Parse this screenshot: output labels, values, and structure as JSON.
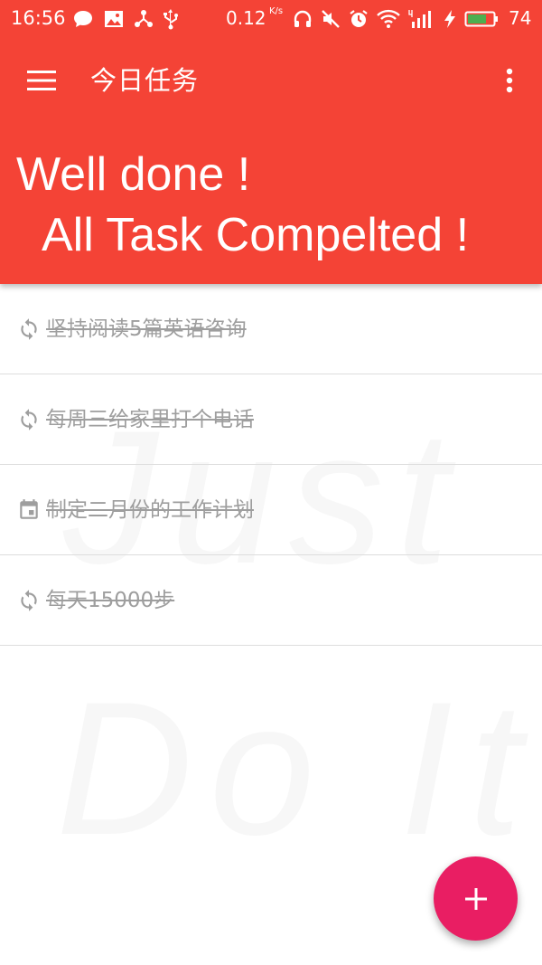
{
  "status_bar": {
    "time": "16:56",
    "net_speed": "0.12",
    "net_speed_unit": "K/s",
    "battery_level": "74",
    "battery_fill_fraction": 0.74,
    "left_icons": [
      "chat-icon",
      "image-icon",
      "share-icon",
      "usb-icon"
    ],
    "right_icons": [
      "headphones-icon",
      "mute-icon",
      "alarm-icon",
      "wifi-icon",
      "signal-4g-icon",
      "charging-icon",
      "battery-icon"
    ]
  },
  "toolbar": {
    "title": "今日任务",
    "menu_icon": "menu-icon",
    "overflow_icon": "more-vert-icon"
  },
  "header": {
    "line1": "Well done !",
    "line2": "All Task Compelted !"
  },
  "tasks": [
    {
      "icon": "repeat-icon",
      "text": "坚持阅读5篇英语咨询",
      "completed": true
    },
    {
      "icon": "repeat-icon",
      "text": "每周三给家里打个电话",
      "completed": true
    },
    {
      "icon": "calendar-icon",
      "text": "制定二月份的工作计划",
      "completed": true
    },
    {
      "icon": "repeat-icon",
      "text": "每天15000步",
      "completed": true
    }
  ],
  "watermark": {
    "line1": "Just",
    "line2": "Do It"
  },
  "fab": {
    "icon": "plus-icon"
  },
  "colors": {
    "header_bg": "#f44336",
    "fab_bg": "#e91e63",
    "task_text": "#9e9e9e",
    "battery_fill": "#4caf50"
  }
}
